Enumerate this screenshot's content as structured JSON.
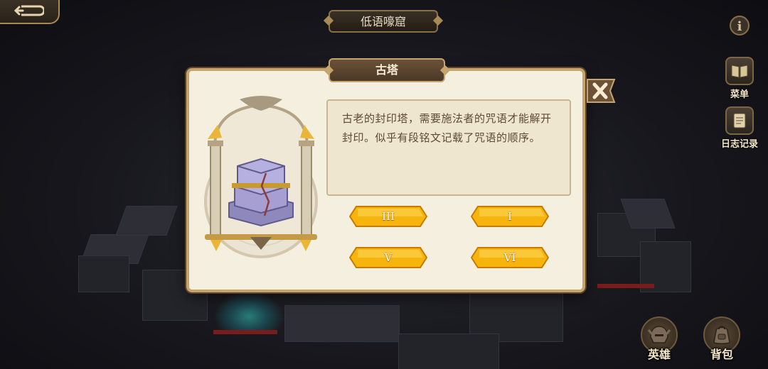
{
  "header": {
    "location_title": "低语嚎窟",
    "info_label": "i"
  },
  "side_menu": {
    "menu_label": "菜单",
    "journal_label": "日志记录"
  },
  "bottom_bar": {
    "heroes_label": "英雄",
    "bag_label": "背包"
  },
  "dialog": {
    "title": "古塔",
    "description": "古老的封印塔，需要施法者的咒语才能解开封印。似乎有段铭文记载了咒语的顺序。",
    "options": [
      "III",
      "I",
      "V",
      "VI"
    ]
  },
  "colors": {
    "panel_bg": "#f5efdf",
    "panel_border": "#c5a46e",
    "button_gold": "#f6b40c",
    "text_brown": "#5d4a35"
  },
  "icons": {
    "back": "back-arrow-icon",
    "info": "info-icon",
    "menu": "book-icon",
    "journal": "scroll-icon",
    "heroes": "helmet-icon",
    "bag": "backpack-icon",
    "close": "close-x-icon"
  }
}
